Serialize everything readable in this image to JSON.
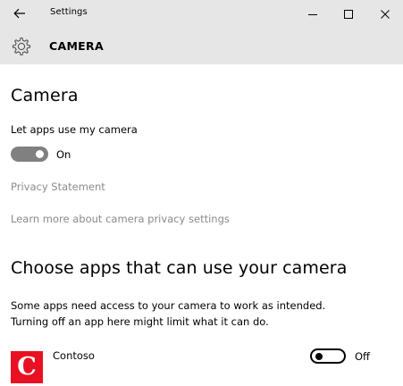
{
  "titlebar": {
    "title": "Settings",
    "back_icon": "back-arrow-icon",
    "minimize_icon": "minimize-icon",
    "maximize_icon": "maximize-icon",
    "close_icon": "close-icon"
  },
  "header": {
    "icon": "gear-icon",
    "title": "CAMERA"
  },
  "camera_section": {
    "title": "Camera",
    "toggle_label": "Let apps use my camera",
    "toggle_state": "On",
    "toggle_on": true,
    "privacy_link": "Privacy Statement",
    "learn_more_link": "Learn more about camera privacy settings"
  },
  "apps_section": {
    "title": "Choose apps that can use your camera",
    "description_line1": "Some apps need access to your camera to work as intended.",
    "description_line2": "Turning off an app here might limit what it can do.",
    "apps": [
      {
        "name": "Contoso",
        "icon_letter": "C",
        "icon_color": "#e81123",
        "toggle_state": "Off",
        "toggle_on": false
      }
    ]
  },
  "colors": {
    "chrome_background": "#e6e6e6",
    "link_gray": "#8a8a8a",
    "toggle_on_gray": "#808080",
    "app_red": "#e81123"
  }
}
